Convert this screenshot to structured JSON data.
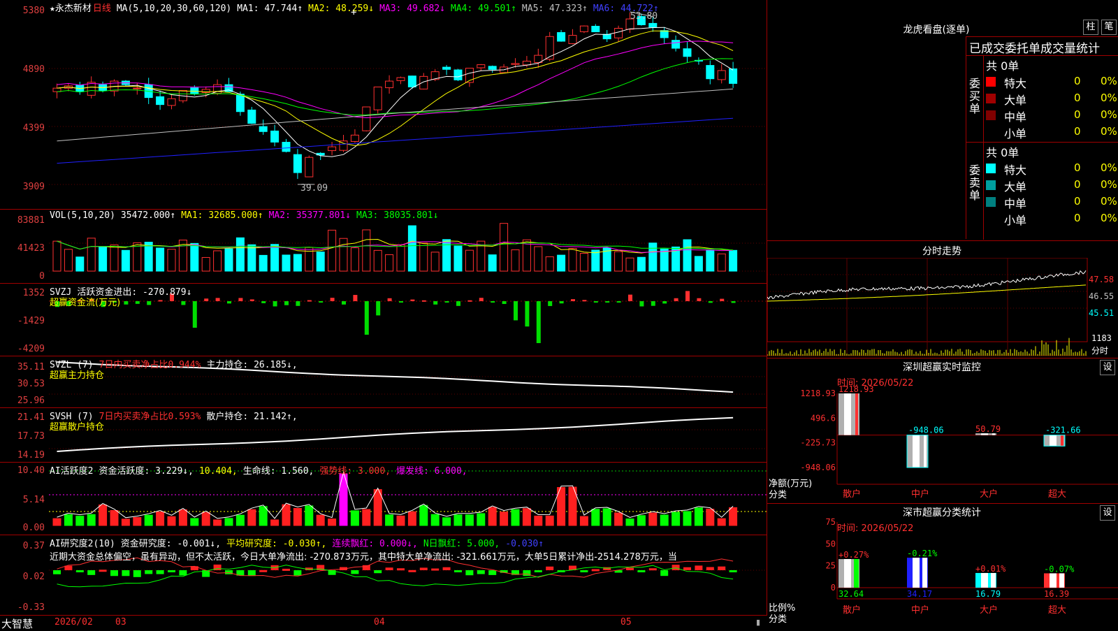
{
  "stock_name": "永杰新材",
  "period": "日线",
  "kline": {
    "ma_label": "MA(5,10,20,30,60,120)",
    "ma1": "MA1: 47.744↑",
    "ma2": "MA2: 48.259↓",
    "ma3": "MA3: 49.682↓",
    "ma4": "MA4: 49.501↑",
    "ma5": "MA5: 47.323↑",
    "ma6": "MA6: 44.722↑",
    "y_ticks": [
      "5380",
      "4890",
      "4399",
      "3909"
    ],
    "high_mark": "53.80",
    "low_mark": "39.09",
    "colors": {
      "up": "#ff3030",
      "down": "#00ffff",
      "ma1": "#ffffff",
      "ma2": "#ffff00",
      "ma3": "#ff00ff",
      "ma4": "#00ff00",
      "ma5": "#c0c0c0",
      "ma6": "#0000ff"
    }
  },
  "vol": {
    "label": "VOL(5,10,20)",
    "value": "35472.000↑",
    "ma1": "MA1: 32685.000↑",
    "ma2": "MA2: 35377.801↓",
    "ma3": "MA3: 38035.801↓",
    "y_ticks": [
      "83881",
      "41423",
      "0"
    ]
  },
  "svzj": {
    "label": "SVZJ",
    "value": "活跃资金进出: -270.879↓",
    "sub": "超赢资金流(万元)",
    "y_ticks": [
      "1352",
      "-1429",
      "-4209"
    ]
  },
  "svzl": {
    "label": "SVZL (7)",
    "ratio": "7日内买卖净占比0.944%",
    "value": "主力持仓: 26.185↓,",
    "sub": "超赢主力持仓",
    "y_ticks": [
      "35.11",
      "30.53",
      "25.96"
    ]
  },
  "svsh": {
    "label": "SVSH (7)",
    "ratio": "7日内买卖净占比0.593%",
    "value": "散户持仓: 21.142↑,",
    "sub": "超赢散户持仓",
    "y_ticks": [
      "21.41",
      "17.73",
      "14.19"
    ]
  },
  "ai_active": {
    "label": "AI活跃度2",
    "v1": "资金活跃度: 3.229↓,",
    "v2": "10.404,",
    "v3": "生命线: 1.560,",
    "v4": "强势线: 3.000,",
    "v5": "爆发线: 6.000,",
    "y_ticks": [
      "10.40",
      "5.14",
      "0.00"
    ]
  },
  "ai_research": {
    "label": "AI研究度2(10)",
    "v1": "资金研究度: -0.001↓,",
    "v2": "平均研究度: -0.030↑,",
    "v3": "连续飘红: 0.000↓,",
    "v4": "N日飘红: 5.000,",
    "v5": "-0.030↑",
    "summary": "近期大资金总体偏空，虽有异动，但不太活跃，今日大单净流出: -270.873万元，其中特大单净流出: -321.661万元，大单5日累计净出-2514.278万元，当",
    "y_ticks": [
      "0.37",
      "0.02",
      "-0.33"
    ]
  },
  "bottom_bar": {
    "brand": "大智慧",
    "dates": [
      "2026/02",
      "03",
      "04",
      "05"
    ]
  },
  "right": {
    "dragon_title": "龙虎看盘(逐单)",
    "btn_zhu": "柱",
    "btn_bi": "笔",
    "stats_title": "已成交委托单成交量统计",
    "buy": {
      "side": "委买单",
      "total": "共 0单",
      "rows": [
        {
          "name": "特大",
          "count": "0",
          "pct": "0%",
          "color": "#ff0000"
        },
        {
          "name": "大单",
          "count": "0",
          "pct": "0%",
          "color": "#a00000"
        },
        {
          "name": "中单",
          "count": "0",
          "pct": "0%",
          "color": "#800000"
        },
        {
          "name": "小单",
          "count": "0",
          "pct": "0%",
          "color": ""
        }
      ]
    },
    "sell": {
      "side": "委卖单",
      "total": "共 0单",
      "rows": [
        {
          "name": "特大",
          "count": "0",
          "pct": "0%",
          "color": "#00ffff"
        },
        {
          "name": "大单",
          "count": "0",
          "pct": "0%",
          "color": "#00a0a0"
        },
        {
          "name": "中单",
          "count": "0",
          "pct": "0%",
          "color": "#008080"
        },
        {
          "name": "小单",
          "count": "0",
          "pct": "0%",
          "color": ""
        }
      ]
    },
    "intraday": {
      "title": "分时走势",
      "y_labels": [
        "47.58",
        "46.55",
        "45.51"
      ],
      "vol_label": "1183",
      "vol_sub": "分时"
    },
    "monitor": {
      "title": "深圳超赢实时监控",
      "settings": "设",
      "time": "时间: 2026/05/22",
      "y_ticks": [
        "1218.93",
        "496.6",
        "-225.73",
        "-948.06"
      ],
      "unit": "净额(万元)",
      "category_label": "分类",
      "categories": [
        "散户",
        "中户",
        "大户",
        "超大"
      ],
      "values": [
        1218.93,
        -948.06,
        50.79,
        -321.66
      ],
      "value_labels": [
        "1218.93",
        "-948.06",
        "50.79",
        "-321.66"
      ]
    },
    "classify": {
      "title": "深市超赢分类统计",
      "settings": "设",
      "time": "时间: 2026/05/22",
      "y_ticks": [
        "75",
        "50",
        "25",
        "0"
      ],
      "ratio_label": "比例%",
      "category_label": "分类",
      "categories": [
        "散户",
        "中户",
        "大户",
        "超大"
      ],
      "values": [
        32.64,
        34.17,
        16.79,
        16.39
      ],
      "changes": [
        "+0.27%",
        "-0.21%",
        "+0.01%",
        "-0.07%"
      ],
      "value_labels": [
        "32.64",
        "34.17",
        "16.79",
        "16.39"
      ]
    }
  },
  "chart_data": {
    "type": "bar",
    "title": "深市超赢分类统计",
    "categories": [
      "散户",
      "中户",
      "大户",
      "超大"
    ],
    "series": [
      {
        "name": "净额(万元)",
        "values": [
          1218.93,
          -948.06,
          50.79,
          -321.66
        ]
      },
      {
        "name": "比例%",
        "values": [
          32.64,
          34.17,
          16.79,
          16.39
        ]
      }
    ],
    "ylim": [
      0,
      75
    ]
  }
}
